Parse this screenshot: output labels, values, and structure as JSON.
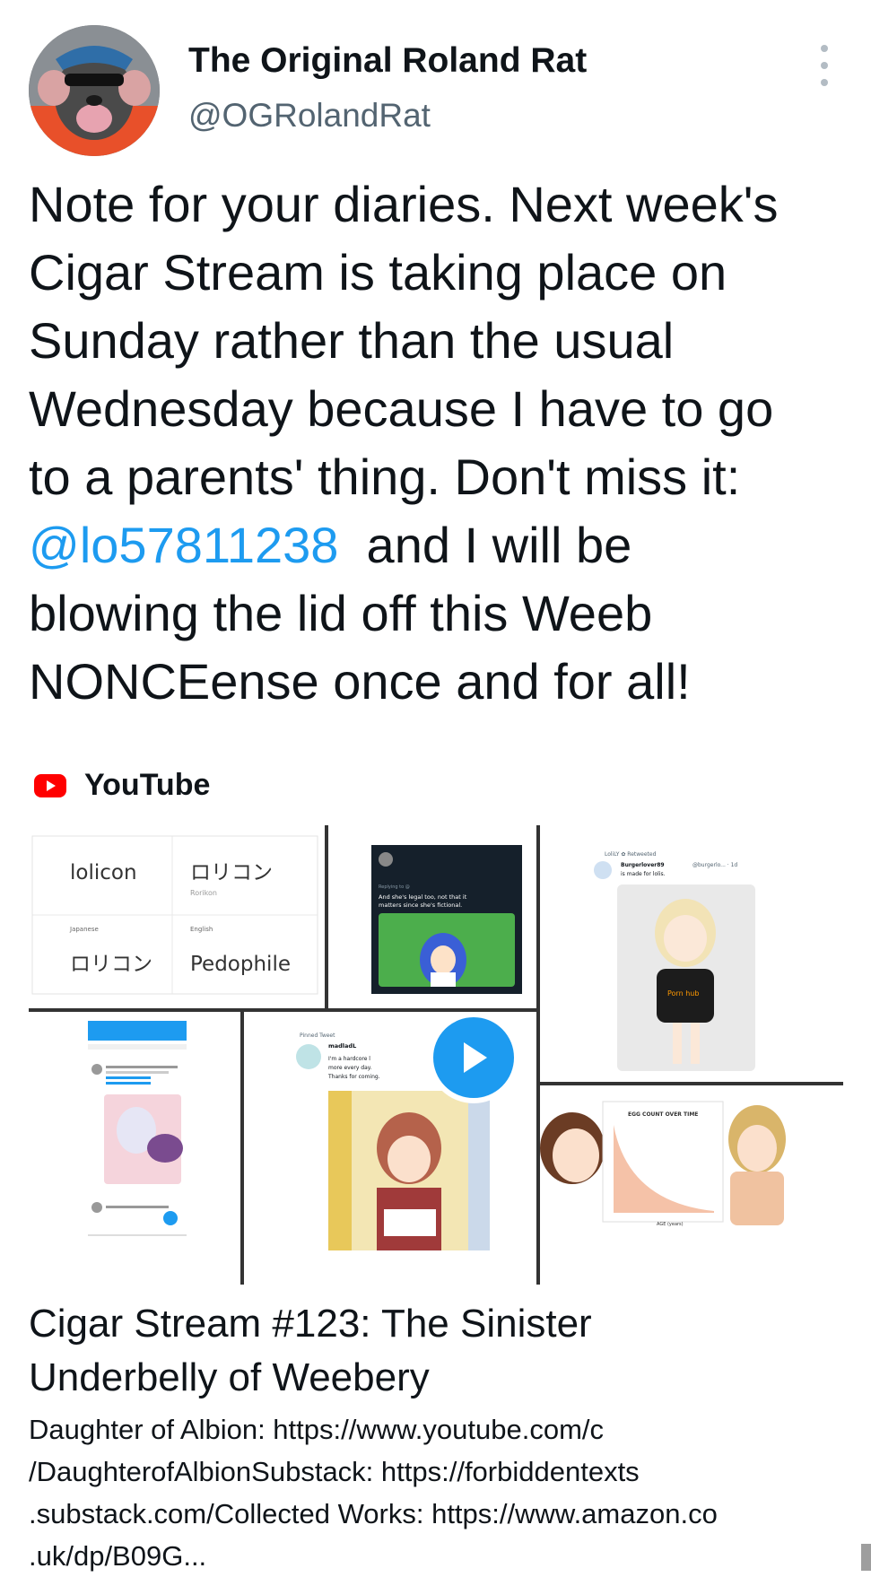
{
  "author": {
    "name": "The Original Roland Rat",
    "handle": "@OGRolandRat"
  },
  "tweet": {
    "line1": "Note for your diaries. Next week's",
    "line2": "Cigar Stream is taking place on",
    "line3": "Sunday rather than the usual",
    "line4": "Wednesday because I have to go",
    "line5": "to a parents' thing. Don't miss it:",
    "mention": "@lo57811238",
    "line6_rest": "  and I will be",
    "line7": "blowing the lid off this Weeb",
    "line8": "NONCEense once and for all!"
  },
  "source": {
    "label": "YouTube",
    "icon": "youtube-logo-icon"
  },
  "thumbnail": {
    "translate": {
      "term_en": "lolicon",
      "term_jp": "ロリコン",
      "romaji": "Rorikon",
      "from_lang": "Japanese",
      "to_lang": "English",
      "from_word": "ロリコン",
      "to_word": "Pedophile"
    },
    "tweet_a": {
      "reply": "Replying to @",
      "text1": "And she's legal too, not that it",
      "text2": "matters since she's fictional."
    },
    "tweet_b": {
      "retweet": "LoliLY ✿ Retweeted",
      "name": "Burgerlover89",
      "handle": "@burgerlo... · 1d",
      "text": "is made for lolis.",
      "shirt": "Porn hub"
    },
    "tweet_c": {
      "pinned": "Pinned Tweet",
      "name": "madladL",
      "line1": "I'm a hardcore l",
      "line2": "more every day.",
      "line3": "Thanks for coming."
    },
    "chart": {
      "title": "EGG COUNT OVER TIME",
      "xlabel": "AGE (years)"
    },
    "play_icon": "play-icon"
  },
  "card": {
    "title_line1": "Cigar Stream #123: The Sinister",
    "title_line2": "Underbelly of Weebery",
    "desc_line1": "Daughter of Albion: https://www.youtube.com/c",
    "desc_line2": "/DaughterofAlbionSubstack: https://forbiddentexts",
    "desc_line3": ".substack.com/Collected Works: https://www.amazon.co",
    "desc_line4": ".uk/dp/B09G..."
  },
  "colors": {
    "text": "#0f1419",
    "secondary": "#536471",
    "link": "#1d9bf0",
    "youtube_red": "#ff0000"
  }
}
